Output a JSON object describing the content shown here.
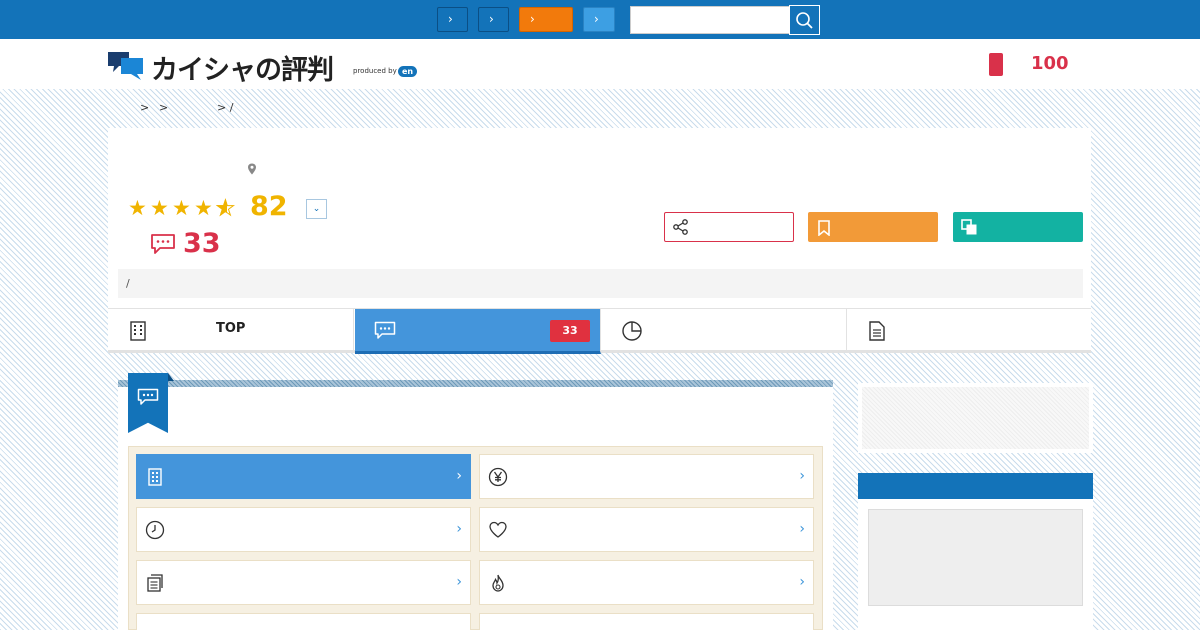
{
  "topbar": {
    "nav_buttons": [
      {
        "label": "›",
        "style": "dark"
      },
      {
        "label": "›",
        "style": "dark"
      },
      {
        "label": "›",
        "style": "orange"
      },
      {
        "label": "›",
        "style": "light"
      }
    ],
    "search_placeholder": "",
    "search_icon": "search-icon"
  },
  "header": {
    "logo_text": "カイシャの評判",
    "logo_produced_by": "produced by",
    "logo_brand": "en",
    "count_icon": "bookmark-icon",
    "count_value": "100"
  },
  "breadcrumb": {
    "items": [
      ">",
      ">",
      "> /"
    ]
  },
  "company": {
    "location_icon": "map-pin-icon",
    "rating_stars": 4.5,
    "stars_text": "★★★★★",
    "score": "82",
    "score_toggle": "⌄",
    "review_icon": "speech-bubble-icon",
    "review_count": "33",
    "info_text": "/"
  },
  "actions": {
    "share_icon": "share-icon",
    "follow_icon": "bookmark-icon",
    "compare_icon": "compare-icon"
  },
  "tabs": [
    {
      "icon": "building-icon",
      "label": "TOP",
      "active": false,
      "badge": ""
    },
    {
      "icon": "speech-bubble-icon",
      "label": "",
      "active": true,
      "badge": "33"
    },
    {
      "icon": "pie-chart-icon",
      "label": "",
      "active": false,
      "badge": ""
    },
    {
      "icon": "document-icon",
      "label": "",
      "active": false,
      "badge": ""
    }
  ],
  "section": {
    "ribbon_icon": "speech-bubble-icon"
  },
  "categories": [
    {
      "icon": "building-icon",
      "active": true,
      "chevron": "›"
    },
    {
      "icon": "yen-icon",
      "active": false,
      "chevron": "›"
    },
    {
      "icon": "clock-icon",
      "active": false,
      "chevron": "›"
    },
    {
      "icon": "heart-icon",
      "active": false,
      "chevron": "›"
    },
    {
      "icon": "documents-icon",
      "active": false,
      "chevron": "›"
    },
    {
      "icon": "flame-icon",
      "active": false,
      "chevron": "›"
    }
  ],
  "colors": {
    "brand_blue": "#1373b9",
    "active_blue": "#4495db",
    "accent_red": "#d9314a",
    "star_gold": "#f0b400",
    "follow_orange": "#f29a38",
    "compare_teal": "#13b2a2"
  }
}
